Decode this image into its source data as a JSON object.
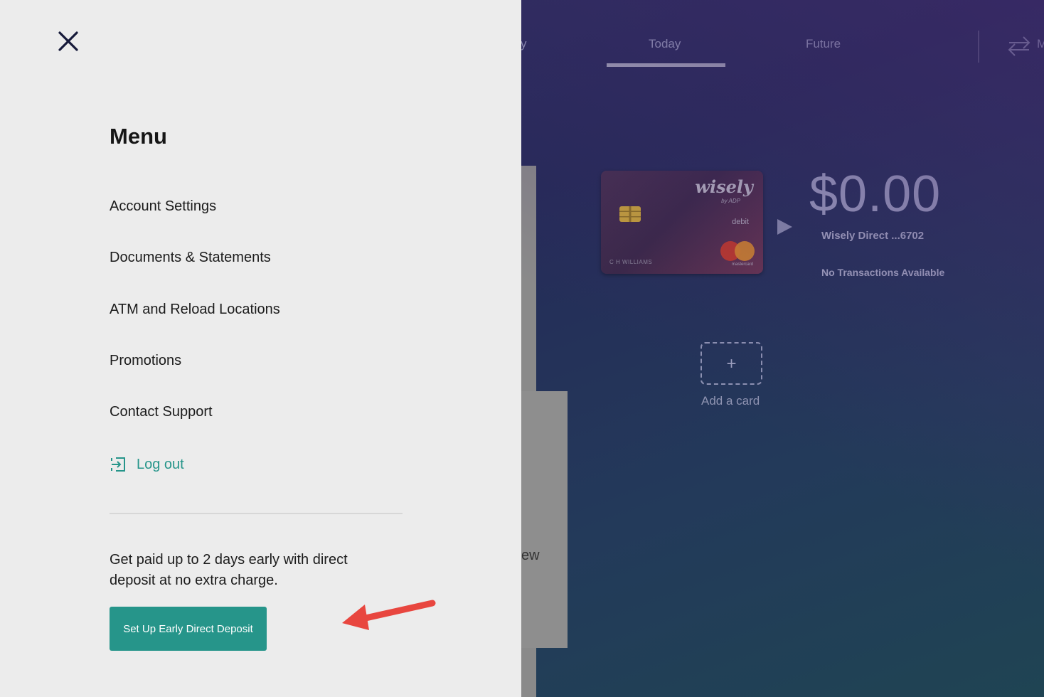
{
  "app": {
    "tabs": [
      {
        "label": "y"
      },
      {
        "label": "Today"
      },
      {
        "label": "Future"
      },
      {
        "label": "M"
      }
    ],
    "panel_text": "ew",
    "card": {
      "brand": "wisely",
      "brand_sub": "by ADP",
      "type": "debit",
      "holder": "C H WILLIAMS",
      "network": "mastercard"
    },
    "balance": "$0.00",
    "account_label": "Wisely Direct ...6702",
    "no_transactions": "No Transactions Available",
    "add_card": {
      "plus": "+",
      "label": "Add a card"
    }
  },
  "menu": {
    "title": "Menu",
    "items": [
      {
        "label": "Account Settings"
      },
      {
        "label": "Documents & Statements"
      },
      {
        "label": "ATM and Reload Locations"
      },
      {
        "label": "Promotions"
      },
      {
        "label": "Contact Support"
      }
    ],
    "logout_label": "Log out",
    "promo_text": "Get paid up to 2 days early with direct deposit at no extra charge.",
    "cta_label": "Set Up Early Direct Deposit"
  },
  "colors": {
    "accent": "#26958a",
    "drawer_bg": "#ececec",
    "arrow": "#e8463f"
  },
  "icons": {
    "close": "close-icon",
    "logout": "logout-icon",
    "transfer": "transfer-arrows-icon",
    "play": "play-icon",
    "annotation": "red-arrow-icon"
  }
}
